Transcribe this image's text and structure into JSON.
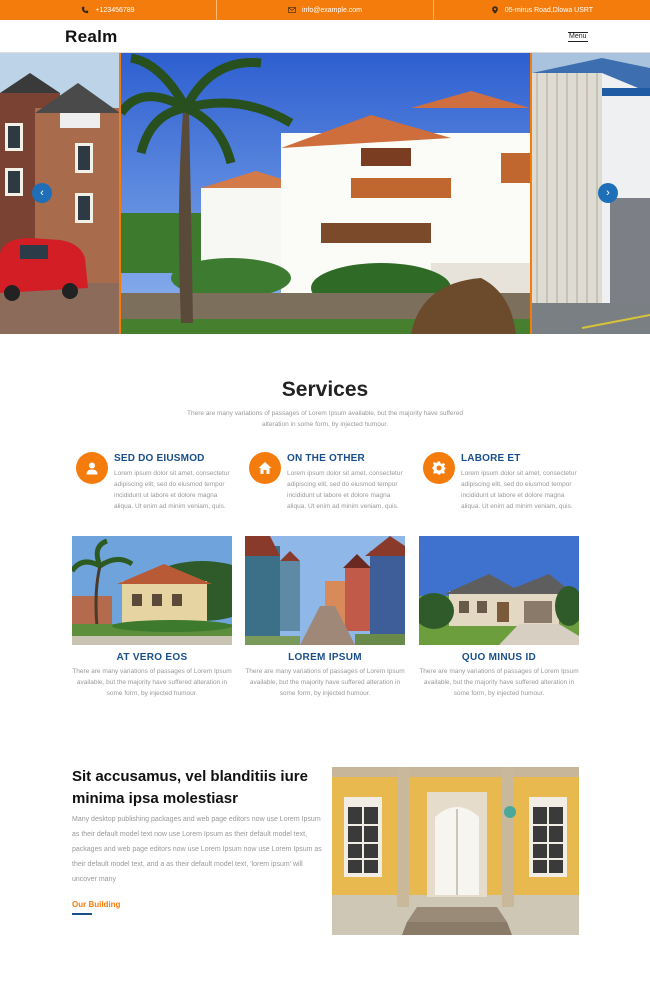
{
  "topbar": {
    "phone": "+123456789",
    "email": "info@example.com",
    "address": "05-mirus Road,Dlowa USRT",
    "phone_icon": "phone-icon",
    "email_icon": "envelope-icon",
    "address_icon": "map-marker-icon"
  },
  "nav": {
    "logo": "Realm",
    "menu_label": "Menu"
  },
  "slider": {
    "prev_icon": "chevron-left-icon",
    "next_icon": "chevron-right-icon",
    "prev_glyph": "‹",
    "next_glyph": "›"
  },
  "services": {
    "title": "Services",
    "subtitle": "There are many variations of passages of Lorem Ipsum available, but the majority have suffered alteration in some form, by injected humour.",
    "features": [
      {
        "title": "SED DO EIUSMOD",
        "icon": "user-icon",
        "text": "Lorem ipsum dolor sit amet, consectetur adipiscing elit, sed do eiusmod tempor incididunt ut labore et dolore magna aliqua. Ut enim ad minim veniam, quis."
      },
      {
        "title": "ON THE OTHER",
        "icon": "home-icon",
        "text": "Lorem ipsum dolor sit amet, consectetur adipiscing elit, sed do eiusmod tempor incididunt ut labore et dolore magna aliqua. Ut enim ad minim veniam, quis."
      },
      {
        "title": "LABORE ET",
        "icon": "gear-icon",
        "text": "Lorem ipsum dolor sit amet, consectetur adipiscing elit, sed do eiusmod tempor incididunt ut labore et dolore magna aliqua. Ut enim ad minim veniam, quis."
      }
    ],
    "cards": [
      {
        "title": "AT VERO EOS",
        "text": "There are many variations of passages of Lorem Ipsum available, but the majority have suffered alteration in some form, by injected humour."
      },
      {
        "title": "LOREM IPSUM",
        "text": "There are many variations of passages of Lorem Ipsum available, but the majority have suffered alteration in some form, by injected humour."
      },
      {
        "title": "QUO MINUS ID",
        "text": "There are many variations of passages of Lorem Ipsum available, but the majority have suffered alteration in some form, by injected humour."
      }
    ]
  },
  "about": {
    "title": "Sit accusamus, vel blanditiis iure minima ipsa molestiasr",
    "text": "Many desktop publishing packages and web page editors now use Lorem Ipsum as their default model text now use Lorem Ipsum as their default model text, packages and web page editors now use Lorem Ipsum now use Lorem Ipsum as their default model text, and a as their default model text, 'lorem ipsum' will uncover many",
    "link": "Our Building"
  },
  "colors": {
    "accent": "#f47c0d",
    "heading_blue": "#1a4f8b",
    "arrow_blue": "#1f6fb8"
  }
}
